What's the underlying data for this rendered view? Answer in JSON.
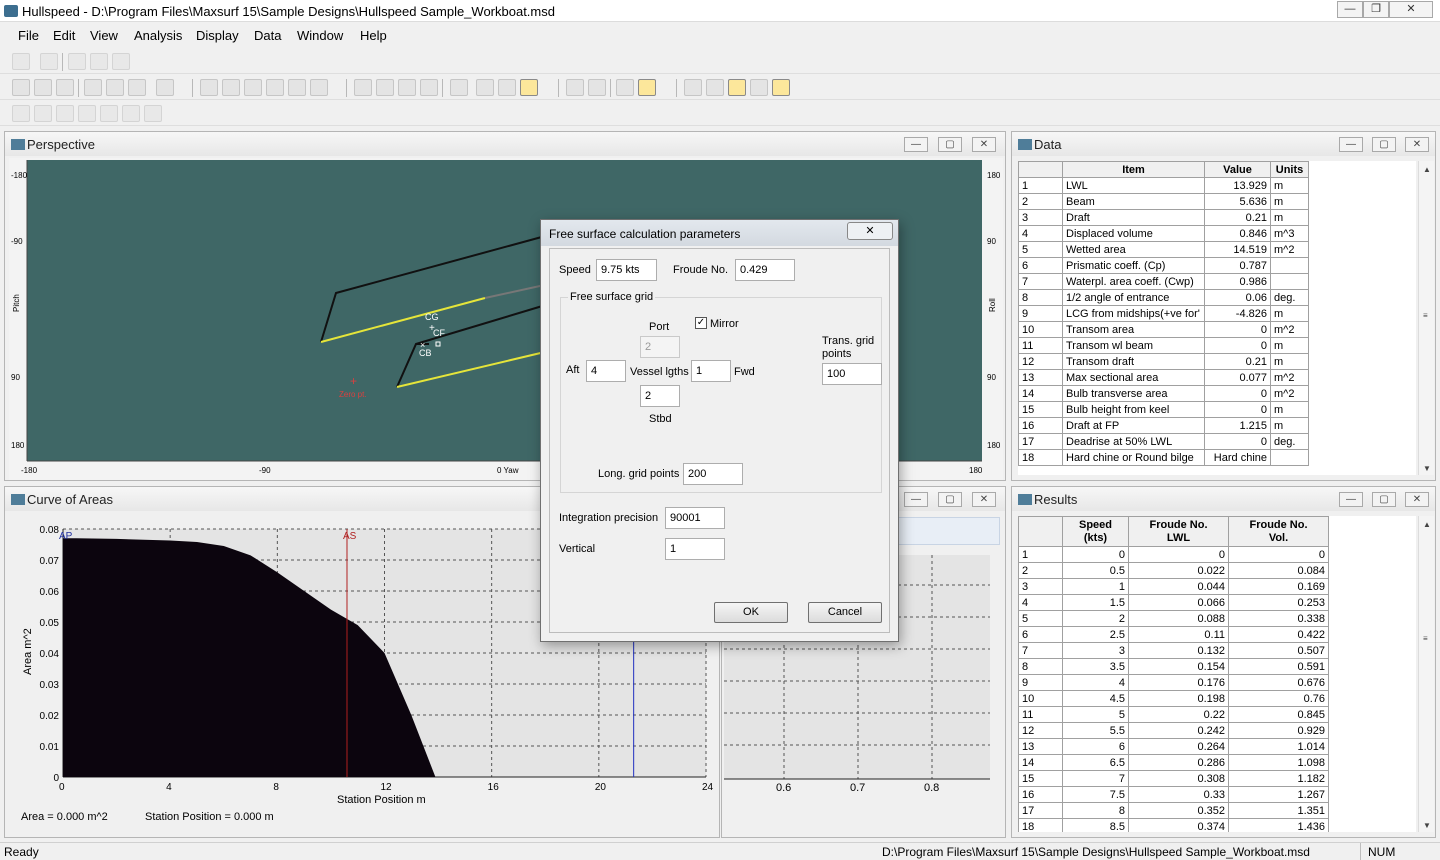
{
  "window": {
    "title": "Hullspeed - D:\\Program Files\\Maxsurf 15\\Sample Designs\\Hullspeed Sample_Workboat.msd"
  },
  "menu": [
    "File",
    "Edit",
    "View",
    "Analysis",
    "Display",
    "Data",
    "Window",
    "Help"
  ],
  "perspective": {
    "title": "Perspective",
    "left_ticks": [
      "-180",
      "-90",
      "Pitch",
      "90",
      "180"
    ],
    "right_ticks": [
      "180",
      "90",
      "Roll",
      "90",
      "180"
    ],
    "bottom_ticks": [
      "-180",
      "-90",
      "0 Yaw",
      "180"
    ],
    "labels": {
      "cg": "CG",
      "cf": "CF",
      "cb": "CB",
      "zero": "Zero pt."
    }
  },
  "curve": {
    "title": "Curve of Areas",
    "ylabel": "Area  m^2",
    "xlabel": "Station Position  m",
    "ap": "AP",
    "as": "AS",
    "area_readout": "Area =  0.000 m^2",
    "station_readout": "Station Position =  0.000 m"
  },
  "chart_data": {
    "type": "area",
    "title": "",
    "xlabel": "Station Position  m",
    "ylabel": "Area  m^2",
    "xlim": [
      0,
      24
    ],
    "ylim": [
      0,
      0.08
    ],
    "x_ticks": [
      "0",
      "4",
      "8",
      "12",
      "16",
      "20",
      "24"
    ],
    "y_ticks": [
      "0",
      "0.01",
      "0.02",
      "0.03",
      "0.04",
      "0.05",
      "0.06",
      "0.07",
      "0.08"
    ],
    "x": [
      0,
      0,
      0.5,
      2,
      4,
      5,
      6,
      7,
      8,
      9,
      10,
      11,
      12,
      13,
      13.9
    ],
    "values": [
      0,
      0.077,
      0.077,
      0.0768,
      0.0763,
      0.0758,
      0.0745,
      0.0715,
      0.066,
      0.06,
      0.054,
      0.049,
      0.04,
      0.02,
      0
    ],
    "markers": [
      {
        "label": "AP",
        "x": 0
      },
      {
        "label": "AS",
        "x": 10.6
      },
      {
        "label": "",
        "x": 21.3
      }
    ],
    "grid": true
  },
  "resistance": {
    "x_ticks": [
      "0.6",
      "0.7",
      "0.8"
    ]
  },
  "data_panel": {
    "title": "Data",
    "headers": [
      "Item",
      "Value",
      "Units"
    ],
    "rows": [
      [
        "1",
        "LWL",
        "13.929",
        "m"
      ],
      [
        "2",
        "Beam",
        "5.636",
        "m"
      ],
      [
        "3",
        "Draft",
        "0.21",
        "m"
      ],
      [
        "4",
        "Displaced volume",
        "0.846",
        "m^3"
      ],
      [
        "5",
        "Wetted area",
        "14.519",
        "m^2"
      ],
      [
        "6",
        "Prismatic coeff. (Cp)",
        "0.787",
        ""
      ],
      [
        "7",
        "Waterpl. area coeff. (Cwp)",
        "0.986",
        ""
      ],
      [
        "8",
        "1/2 angle of entrance",
        "0.06",
        "deg."
      ],
      [
        "9",
        "LCG from midships(+ve for'",
        "-4.826",
        "m"
      ],
      [
        "10",
        "Transom area",
        "0",
        "m^2"
      ],
      [
        "11",
        "Transom wl beam",
        "0",
        "m"
      ],
      [
        "12",
        "Transom draft",
        "0.21",
        "m"
      ],
      [
        "13",
        "Max sectional area",
        "0.077",
        "m^2"
      ],
      [
        "14",
        "Bulb transverse area",
        "0",
        "m^2"
      ],
      [
        "15",
        "Bulb height from keel",
        "0",
        "m"
      ],
      [
        "16",
        "Draft at FP",
        "1.215",
        "m"
      ],
      [
        "17",
        "Deadrise at 50% LWL",
        "0",
        "deg."
      ],
      [
        "18",
        "Hard chine or Round bilge",
        "Hard chine",
        ""
      ]
    ]
  },
  "results_panel": {
    "title": "Results",
    "headers": [
      [
        "Speed",
        "(kts)"
      ],
      [
        "Froude No.",
        "LWL"
      ],
      [
        "Froude No.",
        "Vol."
      ]
    ],
    "rows": [
      [
        "1",
        "0",
        "0",
        "0"
      ],
      [
        "2",
        "0.5",
        "0.022",
        "0.084"
      ],
      [
        "3",
        "1",
        "0.044",
        "0.169"
      ],
      [
        "4",
        "1.5",
        "0.066",
        "0.253"
      ],
      [
        "5",
        "2",
        "0.088",
        "0.338"
      ],
      [
        "6",
        "2.5",
        "0.11",
        "0.422"
      ],
      [
        "7",
        "3",
        "0.132",
        "0.507"
      ],
      [
        "8",
        "3.5",
        "0.154",
        "0.591"
      ],
      [
        "9",
        "4",
        "0.176",
        "0.676"
      ],
      [
        "10",
        "4.5",
        "0.198",
        "0.76"
      ],
      [
        "11",
        "5",
        "0.22",
        "0.845"
      ],
      [
        "12",
        "5.5",
        "0.242",
        "0.929"
      ],
      [
        "13",
        "6",
        "0.264",
        "1.014"
      ],
      [
        "14",
        "6.5",
        "0.286",
        "1.098"
      ],
      [
        "15",
        "7",
        "0.308",
        "1.182"
      ],
      [
        "16",
        "7.5",
        "0.33",
        "1.267"
      ],
      [
        "17",
        "8",
        "0.352",
        "1.351"
      ],
      [
        "18",
        "8.5",
        "0.374",
        "1.436"
      ]
    ]
  },
  "dialog": {
    "title": "Free surface calculation parameters",
    "close": "✕",
    "speed_label": "Speed",
    "speed_value": "9.75 kts",
    "froude_label": "Froude No.",
    "froude_value": "0.429",
    "group_label": "Free surface grid",
    "port_label": "Port",
    "port_value": "2",
    "mirror_label": "Mirror",
    "mirror_checked": true,
    "aft_label": "Aft",
    "aft_value": "4",
    "vessel_label": "Vessel lgths",
    "fwd_value": "1",
    "fwd_label": "Fwd",
    "stbd_value": "2",
    "stbd_label": "Stbd",
    "trans_label_1": "Trans. grid",
    "trans_label_2": "points",
    "trans_value": "100",
    "long_label": "Long. grid points",
    "long_value": "200",
    "precision_label": "Integration precision",
    "precision_value": "90001",
    "vertical_label": "Vertical",
    "vertical_value": "1",
    "ok": "OK",
    "cancel": "Cancel"
  },
  "status": {
    "left": "Ready",
    "path": "D:\\Program Files\\Maxsurf 15\\Sample Designs\\Hullspeed Sample_Workboat.msd",
    "num": "NUM"
  }
}
